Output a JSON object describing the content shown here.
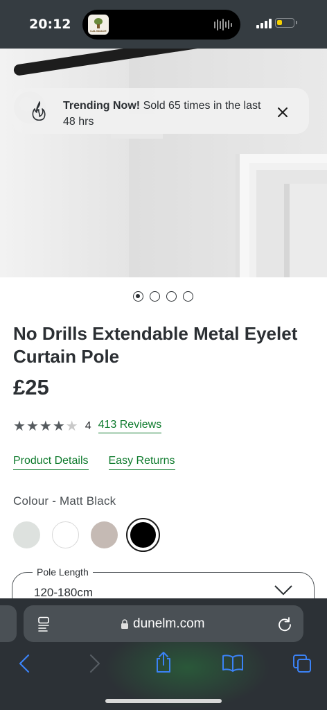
{
  "status_bar": {
    "time": "20:12",
    "app_badge_text": "CALSDADE"
  },
  "hero": {
    "trending_title": "Trending Now!",
    "trending_message": "Sold 65 times in the last 48 hrs",
    "carousel_count": 4,
    "carousel_active_index": 0
  },
  "product": {
    "title": "No Drills Extendable Metal Eyelet Curtain Pole",
    "price": "£25",
    "rating": 4,
    "rating_max": 5,
    "rating_text": "4",
    "reviews_label": "413 Reviews",
    "product_details_label": "Product Details",
    "easy_returns_label": "Easy Returns",
    "colour_label": "Colour - Matt Black",
    "colours": [
      {
        "name": "grey",
        "hex": "#dde1de"
      },
      {
        "name": "white",
        "hex": "#ffffff"
      },
      {
        "name": "taupe",
        "hex": "#c5bab4"
      },
      {
        "name": "matt-black",
        "hex": "#000000",
        "selected": true
      }
    ],
    "pole_length_label": "Pole Length",
    "pole_length_value": "120-180cm"
  },
  "browser": {
    "url": "dunelm.com"
  },
  "colors": {
    "link_green": "#0d7a2c",
    "status_bar_bg": "#353c41",
    "browser_bg": "#2c3136",
    "ios_blue": "#3b82f6"
  }
}
